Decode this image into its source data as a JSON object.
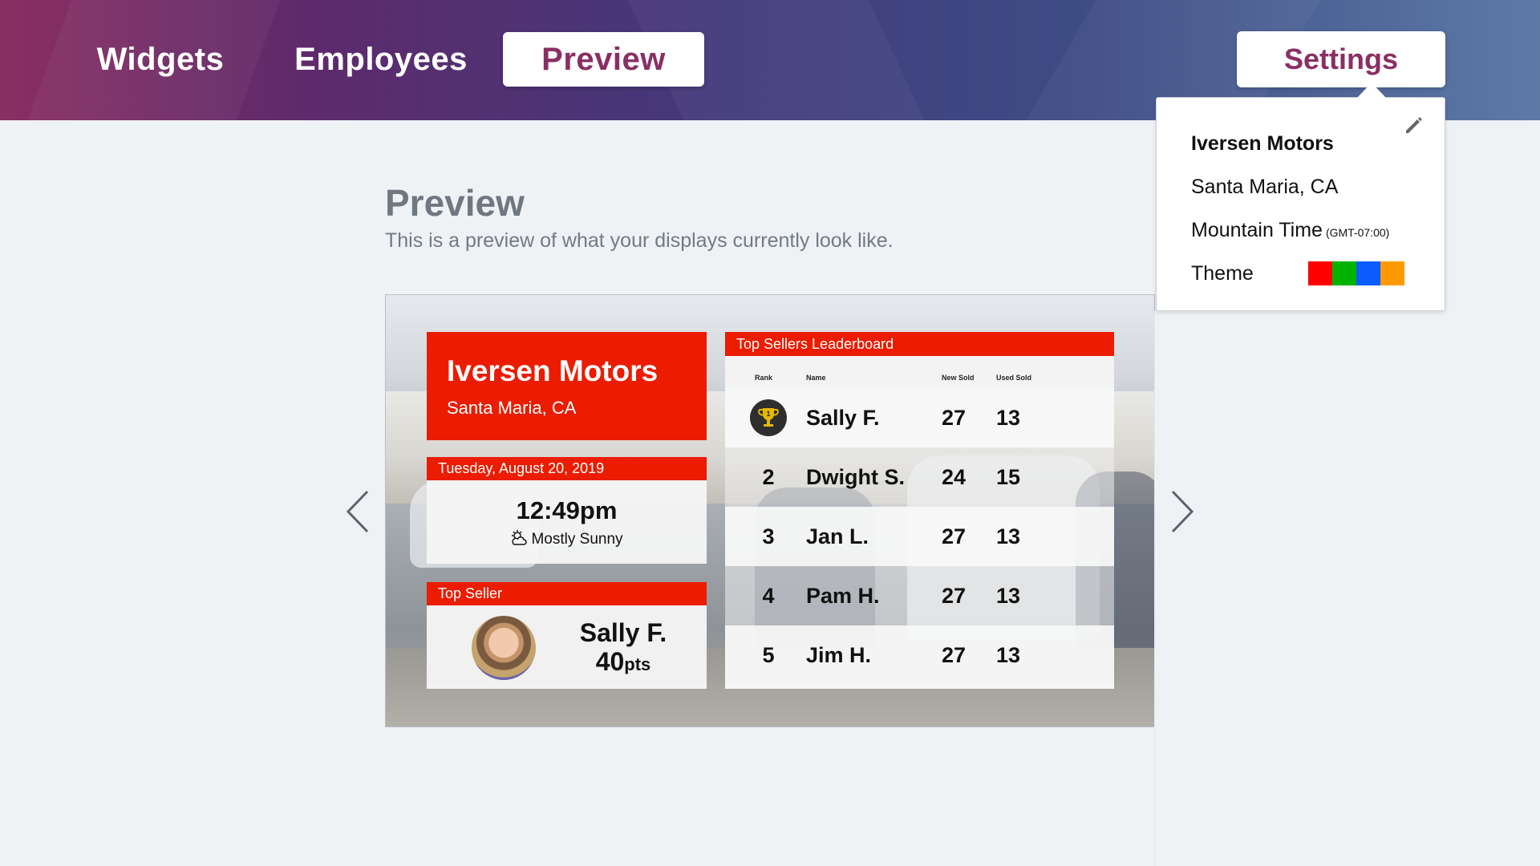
{
  "nav": {
    "tabs": [
      {
        "label": "Widgets"
      },
      {
        "label": "Employees"
      },
      {
        "label": "Preview"
      }
    ],
    "settings_label": "Settings"
  },
  "page": {
    "title": "Preview",
    "subtitle": "This is a preview of what your displays currently look like."
  },
  "display": {
    "dealer": {
      "name": "Iversen Motors",
      "location": "Santa Maria, CA"
    },
    "date": "Tuesday, August 20, 2019",
    "time": "12:49pm",
    "weather": "Mostly Sunny",
    "top_seller": {
      "title": "Top Seller",
      "name": "Sally F.",
      "points": "40",
      "points_unit": "pts"
    },
    "leaderboard": {
      "title": "Top Sellers Leaderboard",
      "columns": [
        "Rank",
        "Name",
        "New Sold",
        "Used Sold"
      ],
      "rows": [
        {
          "rank": "1",
          "name": "Sally F.",
          "new_sold": "27",
          "used_sold": "13"
        },
        {
          "rank": "2",
          "name": "Dwight S.",
          "new_sold": "24",
          "used_sold": "15"
        },
        {
          "rank": "3",
          "name": "Jan L.",
          "new_sold": "27",
          "used_sold": "13"
        },
        {
          "rank": "4",
          "name": "Pam H.",
          "new_sold": "27",
          "used_sold": "13"
        },
        {
          "rank": "5",
          "name": "Jim H.",
          "new_sold": "27",
          "used_sold": "13"
        }
      ]
    }
  },
  "settings": {
    "dealer_name": "Iversen Motors",
    "location": "Santa Maria, CA",
    "timezone": "Mountain Time",
    "timezone_offset": "(GMT-07:00)",
    "theme_label": "Theme",
    "theme_colors": [
      "#ff0000",
      "#00b400",
      "#0a5cff",
      "#ff9900"
    ]
  },
  "colors": {
    "brand": "#8a2f63",
    "display_accent": "#eb1c00"
  }
}
